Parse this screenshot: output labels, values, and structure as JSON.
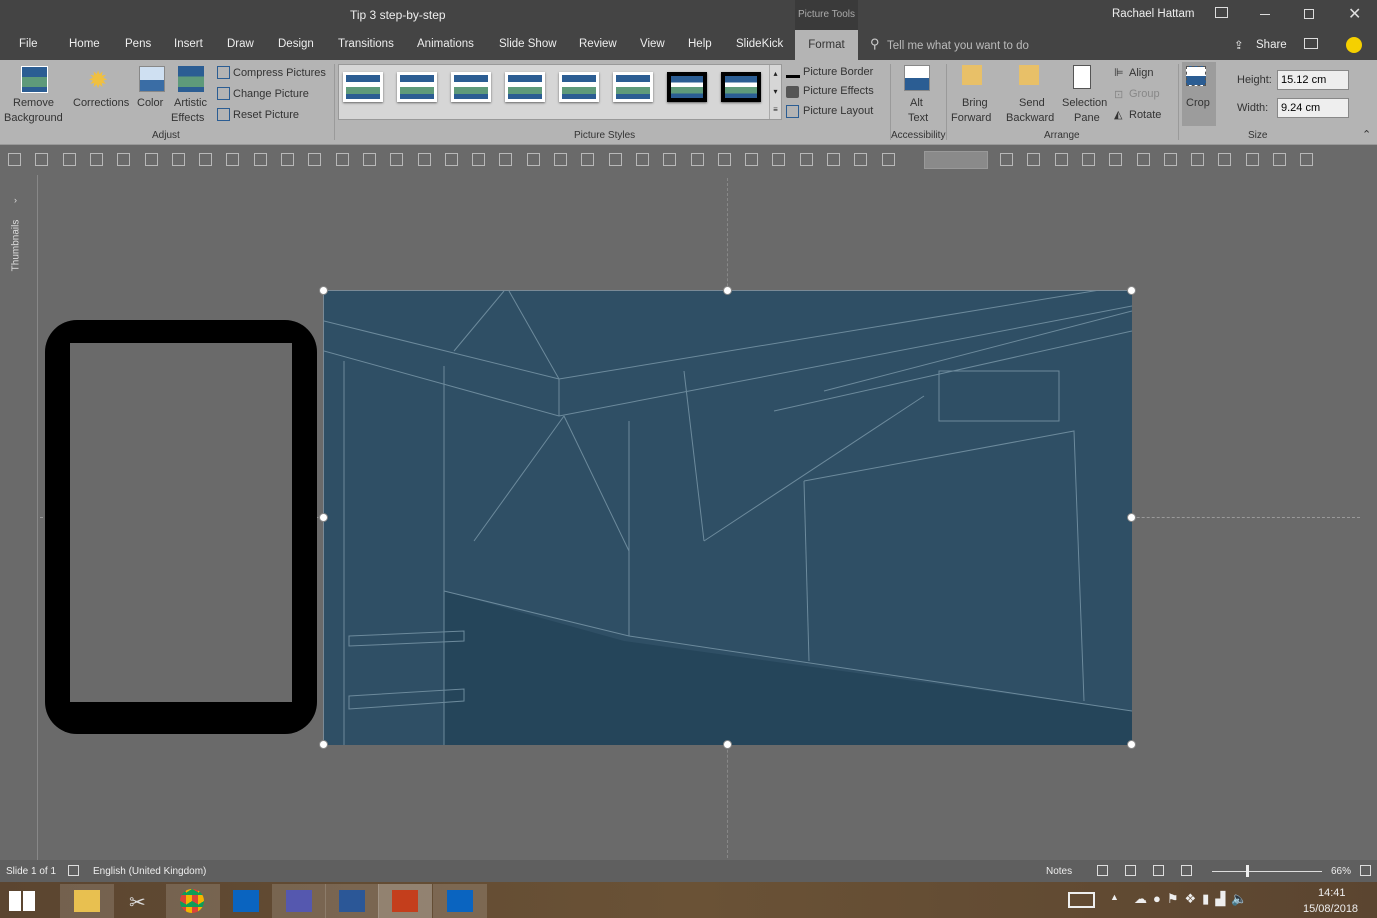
{
  "title": "Tip 3 step-by-step",
  "context_tab": "Picture Tools",
  "user": "Rachael Hattam",
  "tabs": [
    "File",
    "Home",
    "Pens",
    "Insert",
    "Draw",
    "Design",
    "Transitions",
    "Animations",
    "Slide Show",
    "Review",
    "View",
    "Help",
    "SlideKick"
  ],
  "active_tab": "Format",
  "search_placeholder": "Tell me what you want to do",
  "share": "Share",
  "ribbon": {
    "adjust": {
      "remove_bg": [
        "Remove",
        "Background"
      ],
      "corrections": "Corrections",
      "color": "Color",
      "artistic": [
        "Artistic",
        "Effects"
      ],
      "compress": "Compress Pictures",
      "change": "Change Picture",
      "reset": "Reset Picture",
      "label": "Adjust"
    },
    "styles": {
      "label": "Picture Styles",
      "border": "Picture Border",
      "effects": "Picture Effects",
      "layout": "Picture Layout"
    },
    "accessibility": {
      "alt": [
        "Alt",
        "Text"
      ],
      "label": "Accessibility"
    },
    "arrange": {
      "bring": [
        "Bring",
        "Forward"
      ],
      "send": [
        "Send",
        "Backward"
      ],
      "selection": [
        "Selection",
        "Pane"
      ],
      "align": "Align",
      "group": "Group",
      "rotate": "Rotate",
      "label": "Arrange"
    },
    "size": {
      "crop": "Crop",
      "height_label": "Height:",
      "height": "15.12 cm",
      "width_label": "Width:",
      "width": "9.24 cm",
      "label": "Size"
    }
  },
  "thumbnails_label": "Thumbnails",
  "status": {
    "slide": "Slide 1 of 1",
    "language": "English (United Kingdom)",
    "notes": "Notes",
    "zoom": "66%"
  },
  "taskbar": {
    "time": "14:41",
    "date": "15/08/2018"
  },
  "colors": {
    "picture": "#34566d",
    "accent": "#c43e1c"
  }
}
